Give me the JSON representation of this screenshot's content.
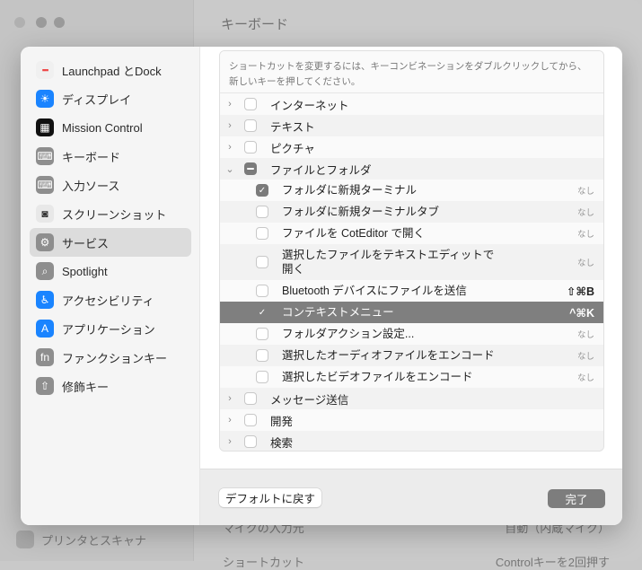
{
  "window": {
    "title": "キーボード"
  },
  "background": {
    "sidebar_item": "プリンタとスキャナ",
    "rows": [
      {
        "label": "マイクの入力元",
        "value": "自動（内蔵マイク）"
      },
      {
        "label": "ショートカット",
        "value": "Controlキーを2回押す"
      }
    ]
  },
  "sidebar": {
    "items": [
      {
        "label": "Launchpad とDock",
        "icon": "launchpad-icon",
        "color": "#f0f0f0"
      },
      {
        "label": "ディスプレイ",
        "icon": "display-icon",
        "color": "#1a84ff"
      },
      {
        "label": "Mission Control",
        "icon": "mission-control-icon",
        "color": "#111111"
      },
      {
        "label": "キーボード",
        "icon": "keyboard-icon",
        "color": "#8e8e8e"
      },
      {
        "label": "入力ソース",
        "icon": "input-source-icon",
        "color": "#8e8e8e"
      },
      {
        "label": "スクリーンショット",
        "icon": "screenshot-icon",
        "color": "#e8e8e8"
      },
      {
        "label": "サービス",
        "icon": "services-icon",
        "color": "#8e8e8e",
        "selected": true
      },
      {
        "label": "Spotlight",
        "icon": "spotlight-icon",
        "color": "#8e8e8e"
      },
      {
        "label": "アクセシビリティ",
        "icon": "accessibility-icon",
        "color": "#1a84ff"
      },
      {
        "label": "アプリケーション",
        "icon": "app-store-icon",
        "color": "#1a84ff"
      },
      {
        "label": "ファンクションキー",
        "icon": "fn-key-icon",
        "color": "#8e8e8e"
      },
      {
        "label": "修飾キー",
        "icon": "modifier-key-icon",
        "color": "#8e8e8e"
      }
    ]
  },
  "list": {
    "hint": "ショートカットを変更するには、キーコンビネーションをダブルクリックしてから、新しいキーを押してください。",
    "rows": [
      {
        "label": "インターネット",
        "level": 0,
        "expanded": false,
        "state": "off"
      },
      {
        "label": "テキスト",
        "level": 0,
        "expanded": false,
        "state": "off"
      },
      {
        "label": "ピクチャ",
        "level": 0,
        "expanded": false,
        "state": "off"
      },
      {
        "label": "ファイルとフォルダ",
        "level": 0,
        "expanded": true,
        "state": "mixed"
      },
      {
        "label": "フォルダに新規ターミナル",
        "level": 1,
        "state": "on",
        "shortcut": "なし"
      },
      {
        "label": "フォルダに新規ターミナルタブ",
        "level": 1,
        "state": "off",
        "shortcut": "なし"
      },
      {
        "label": "ファイルを CotEditor で開く",
        "level": 1,
        "state": "off",
        "shortcut": "なし"
      },
      {
        "label": "選択したファイルをテキストエディットで開く",
        "level": 1,
        "state": "off",
        "shortcut": "なし",
        "tall": true
      },
      {
        "label": "Bluetooth デバイスにファイルを送信",
        "level": 1,
        "state": "off",
        "shortcut": "⇧⌘B"
      },
      {
        "label": "コンテキストメニュー",
        "level": 1,
        "state": "on",
        "shortcut": "^⌘K",
        "selected": true
      },
      {
        "label": "フォルダアクション設定...",
        "level": 1,
        "state": "off",
        "shortcut": "なし"
      },
      {
        "label": "選択したオーディオファイルをエンコード",
        "level": 1,
        "state": "off",
        "shortcut": "なし"
      },
      {
        "label": "選択したビデオファイルをエンコード",
        "level": 1,
        "state": "off",
        "shortcut": "なし"
      },
      {
        "label": "メッセージ送信",
        "level": 0,
        "expanded": false,
        "state": "off"
      },
      {
        "label": "開発",
        "level": 0,
        "expanded": false,
        "state": "off"
      },
      {
        "label": "検索",
        "level": 0,
        "expanded": false,
        "state": "off"
      }
    ]
  },
  "footer": {
    "restore_label": "デフォルトに戻す",
    "done_label": "完了"
  }
}
